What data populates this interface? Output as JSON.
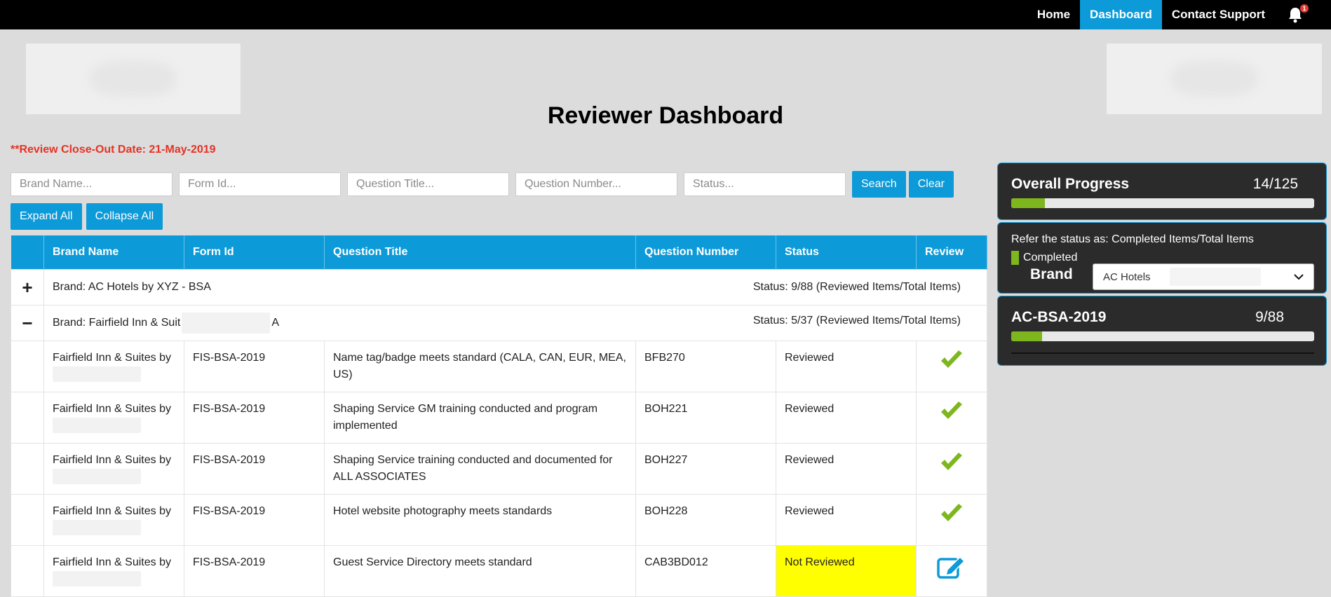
{
  "nav": {
    "items": [
      {
        "label": "Home",
        "active": false
      },
      {
        "label": "Dashboard",
        "active": true
      },
      {
        "label": "Contact Support",
        "active": false
      }
    ],
    "notification_count": "1"
  },
  "page": {
    "title": "Reviewer Dashboard",
    "closeout_date": "**Review Close-Out Date: 21-May-2019"
  },
  "filters": {
    "brand_placeholder": "Brand Name...",
    "form_placeholder": "Form Id...",
    "question_title_placeholder": "Question Title...",
    "question_number_placeholder": "Question Number...",
    "status_placeholder": "Status...",
    "search_label": "Search",
    "clear_label": "Clear",
    "expand_label": "Expand All",
    "collapse_label": "Collapse All"
  },
  "table": {
    "headers": [
      "Brand Name",
      "Form Id",
      "Question Title",
      "Question Number",
      "Status",
      "Review"
    ],
    "groups": [
      {
        "toggle": "+",
        "label": "Brand: AC Hotels by XYZ - BSA",
        "status": "Status: 9/88 (Reviewed Items/Total Items)"
      },
      {
        "toggle": "−",
        "label_start": "Brand: Fairfield Inn & Suit",
        "label_end": "A",
        "status": "Status: 5/37 (Reviewed Items/Total Items)"
      }
    ],
    "rows": [
      {
        "brand": "Fairfield Inn & Suites by",
        "form": "FIS-BSA-2019",
        "title": "Name tag/badge meets standard (CALA, CAN, EUR, MEA, US)",
        "number": "BFB270",
        "status": "Reviewed",
        "review_icon": "check-icon"
      },
      {
        "brand": "Fairfield Inn & Suites by",
        "form": "FIS-BSA-2019",
        "title": "Shaping Service GM training conducted and program implemented",
        "number": "BOH221",
        "status": "Reviewed",
        "review_icon": "check-icon"
      },
      {
        "brand": "Fairfield Inn & Suites by",
        "form": "FIS-BSA-2019",
        "title": "Shaping Service training conducted and documented for ALL ASSOCIATES",
        "number": "BOH227",
        "status": "Reviewed",
        "review_icon": "check-icon"
      },
      {
        "brand": "Fairfield Inn & Suites by",
        "form": "FIS-BSA-2019",
        "title": "Hotel website photography meets standards",
        "number": "BOH228",
        "status": "Reviewed",
        "review_icon": "check-icon"
      },
      {
        "brand": "Fairfield Inn & Suites by",
        "form": "FIS-BSA-2019",
        "title": "Guest Service Directory meets standard",
        "number": "CAB3BD012",
        "status": "Not Reviewed",
        "review_icon": "edit-icon"
      }
    ]
  },
  "sidebar": {
    "overall": {
      "title": "Overall Progress",
      "count": "14/125",
      "progress": 0.112
    },
    "legend": {
      "text": "Refer the status as: Completed Items/Total Items",
      "completed_label": "Completed"
    },
    "brand": {
      "label": "Brand",
      "selected": "AC Hotels"
    },
    "form": {
      "title": "AC-BSA-2019",
      "count": "9/88",
      "progress": 0.102
    }
  },
  "colors": {
    "accent": "#0d9ad8",
    "progress_fill": "#7db71d",
    "check": "#7db71d",
    "not_reviewed_bg": "#ffff00",
    "closeout_text": "#e53324"
  }
}
